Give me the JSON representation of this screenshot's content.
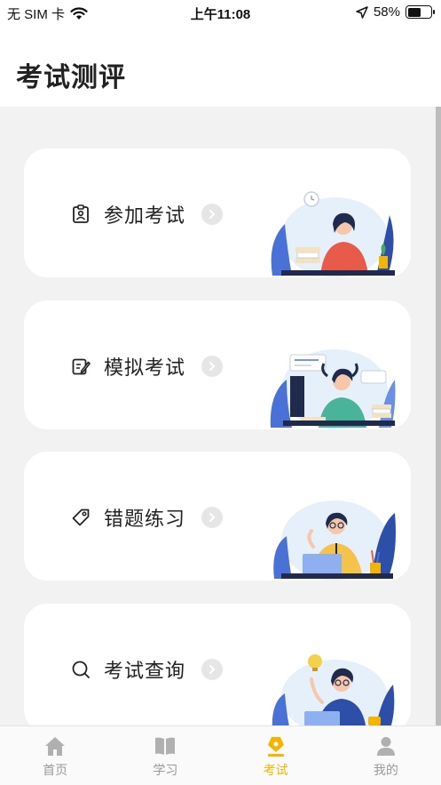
{
  "status_bar": {
    "carrier": "无 SIM 卡",
    "time": "上午11:08",
    "battery": "58%",
    "battery_level": 0.58
  },
  "header": {
    "title": "考试测评"
  },
  "cards": [
    {
      "label": "参加考试",
      "icon": "badge-icon"
    },
    {
      "label": "模拟考试",
      "icon": "edit-icon"
    },
    {
      "label": "错题练习",
      "icon": "tag-icon"
    },
    {
      "label": "考试查询",
      "icon": "search-icon"
    }
  ],
  "tabs": [
    {
      "label": "首页",
      "icon": "home-icon",
      "active": false
    },
    {
      "label": "学习",
      "icon": "book-icon",
      "active": false
    },
    {
      "label": "考试",
      "icon": "exam-icon",
      "active": true
    },
    {
      "label": "我的",
      "icon": "user-icon",
      "active": false
    }
  ],
  "colors": {
    "accent": "#f5b400",
    "tab_inactive": "#9a9a9a",
    "background": "#f2f2f2"
  }
}
